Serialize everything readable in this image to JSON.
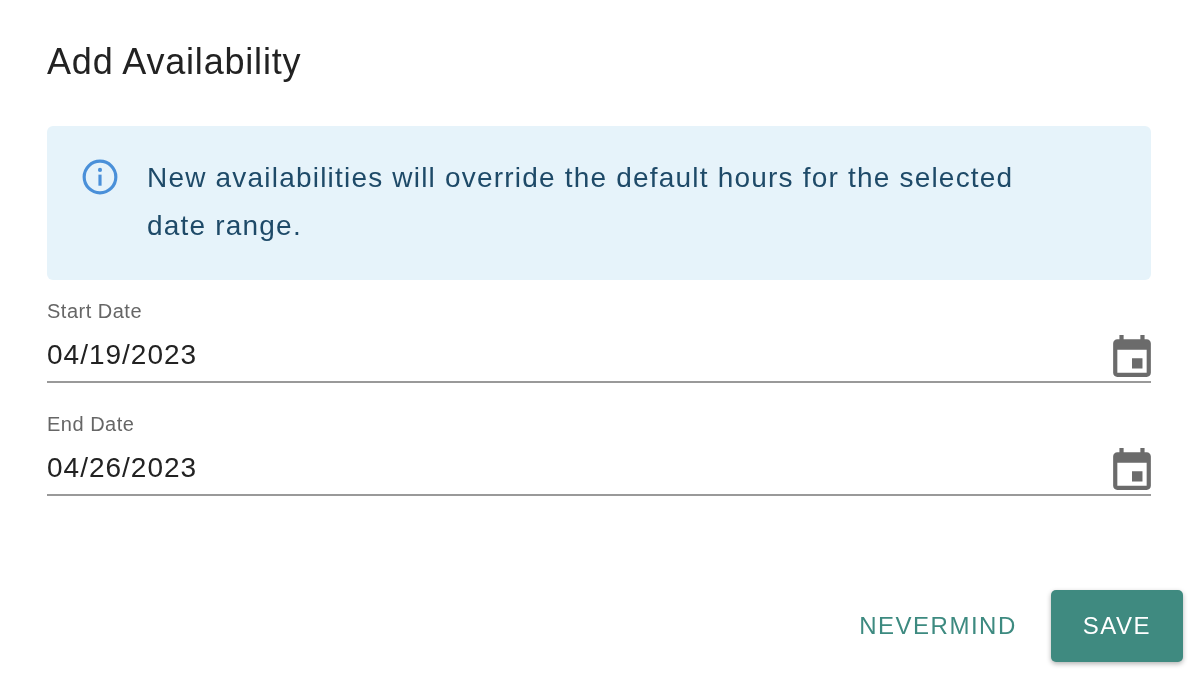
{
  "dialog": {
    "title": "Add Availability"
  },
  "notice": {
    "text": "New availabilities will override the default hours for the selected date range."
  },
  "fields": [
    {
      "label": "Start Date",
      "value": "04/19/2023"
    },
    {
      "label": "End Date",
      "value": "04/26/2023"
    }
  ],
  "buttons": [
    {
      "label": "NEVERMIND",
      "kind": "text"
    },
    {
      "label": "SAVE",
      "kind": "contained"
    }
  ]
}
